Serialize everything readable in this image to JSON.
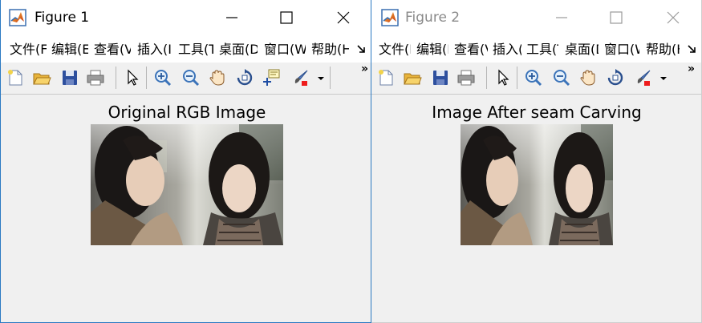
{
  "windows": [
    {
      "title": "Figure 1",
      "menu": [
        "文件(F)",
        "编辑(E)",
        "查看(V)",
        "插入(I)",
        "工具(T)",
        "桌面(D)",
        "窗口(W)",
        "帮助(H)"
      ],
      "figure_title": "Original RGB Image",
      "toolbar_more": "»"
    },
    {
      "title": "Figure 2",
      "menu": [
        "文件(F)",
        "编辑(E)",
        "查看(V)",
        "插入(I)",
        "工具(T)",
        "桌面(D)",
        "窗口(W)",
        "帮助(H)"
      ],
      "figure_title": "Image After seam Carving",
      "toolbar_more": "»"
    }
  ],
  "icons": {
    "window_controls": [
      "minimize-icon",
      "maximize-icon",
      "close-icon"
    ],
    "toolbar_figure1": [
      "new-figure-icon",
      "open-file-icon",
      "save-icon",
      "print-icon",
      "select-pointer-icon",
      "zoom-in-icon",
      "zoom-out-icon",
      "pan-hand-icon",
      "rotate-3d-icon",
      "data-cursor-icon",
      "brush-icon",
      "dropdown-arrow-icon"
    ],
    "toolbar_figure2": [
      "new-figure-icon",
      "open-file-icon",
      "save-icon",
      "print-icon",
      "select-pointer-icon",
      "zoom-in-icon",
      "zoom-out-icon",
      "pan-hand-icon",
      "rotate-3d-icon",
      "brush-icon",
      "dropdown-arrow-icon"
    ]
  },
  "colors": {
    "window_background": "#f0f0f0",
    "active_border": "#2b79c2",
    "inactive_title_text": "#8a8a8a"
  }
}
